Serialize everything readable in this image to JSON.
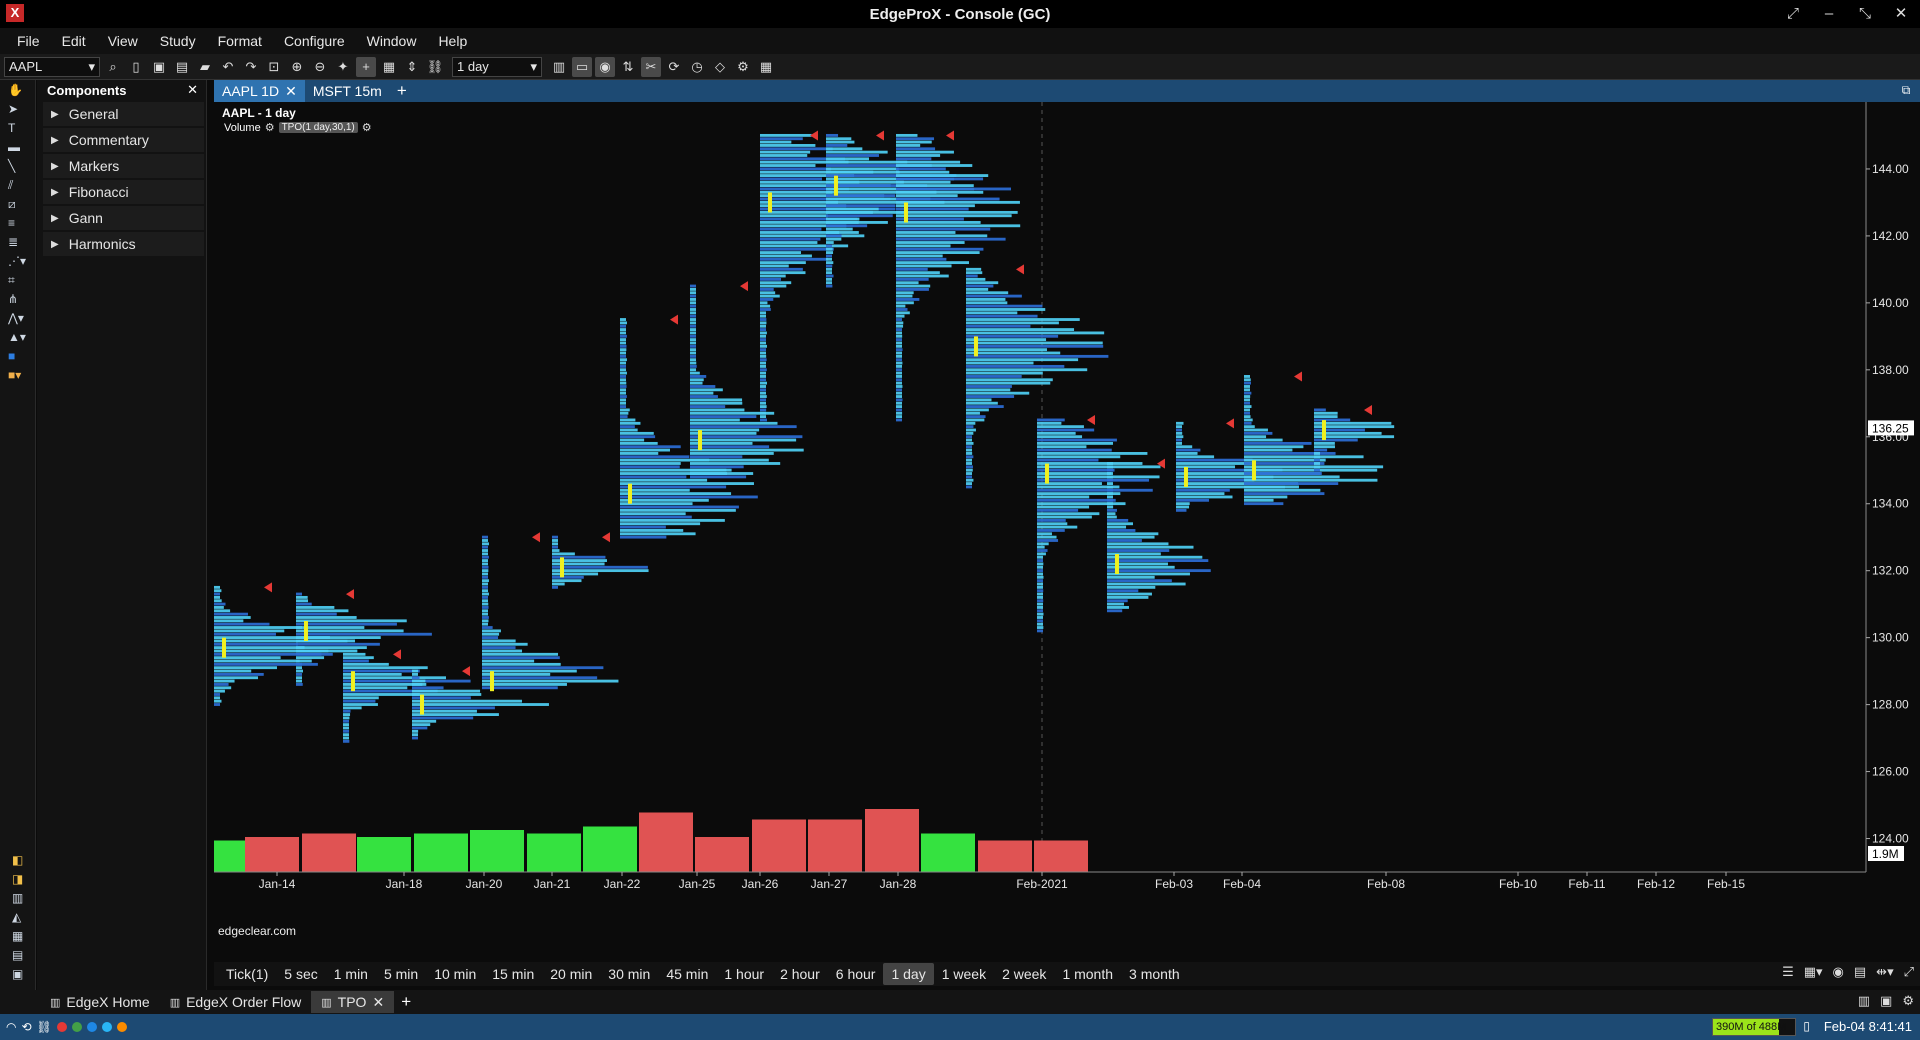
{
  "window": {
    "title": "EdgeProX - Console (GC)",
    "logo": "X"
  },
  "menu": [
    "File",
    "Edit",
    "View",
    "Study",
    "Format",
    "Configure",
    "Window",
    "Help"
  ],
  "toolbar": {
    "symbol": "AAPL",
    "interval": "1 day"
  },
  "components": {
    "title": "Components",
    "items": [
      "General",
      "Commentary",
      "Markers",
      "Fibonacci",
      "Gann",
      "Harmonics"
    ]
  },
  "chart_tabs": [
    {
      "label": "AAPL 1D",
      "active": true
    },
    {
      "label": "MSFT 15m",
      "active": false
    }
  ],
  "chart": {
    "legend_title": "AAPL - 1 day",
    "legend_volume": "Volume",
    "legend_tpo": "TPO(1 day,30,1)",
    "watermark": "edgeclear.com",
    "last_price_label": "136.25",
    "volume_label": "1.9M"
  },
  "chart_data": {
    "type": "bar",
    "description_series": "TPO profiles per day with volume histogram",
    "y_ticks": [
      "144.00",
      "142.00",
      "140.00",
      "138.00",
      "136.00",
      "134.00",
      "132.00",
      "130.00",
      "128.00",
      "126.00",
      "124.00"
    ],
    "ylim": [
      123.0,
      146.0
    ],
    "x_ticks": [
      "Jan-14",
      "Jan-18",
      "Jan-20",
      "Jan-21",
      "Jan-22",
      "Jan-25",
      "Jan-26",
      "Jan-27",
      "Jan-28",
      "Feb-2021",
      "Feb-03",
      "Feb-04",
      "Feb-08",
      "Feb-10",
      "Feb-11",
      "Feb-12",
      "Feb-15"
    ],
    "days": [
      {
        "date": "Jan-14",
        "low": 128.0,
        "high": 131.5,
        "poc": 129.7,
        "width": 1.0,
        "volume": 0.45,
        "up": true
      },
      {
        "date": "Jan-15",
        "low": 128.6,
        "high": 131.3,
        "poc": 130.2,
        "width": 1.0,
        "volume": 0.5,
        "up": false
      },
      {
        "date": "Jan-19",
        "low": 126.9,
        "high": 129.5,
        "poc": 128.7,
        "width": 1.0,
        "volume": 0.55,
        "up": false
      },
      {
        "date": "Jan-20",
        "low": 127.0,
        "high": 129.0,
        "poc": 128.0,
        "width": 1.0,
        "volume": 0.5,
        "up": true
      },
      {
        "date": "Jan-21",
        "low": 128.5,
        "high": 133.0,
        "poc": 128.7,
        "width": 1.0,
        "volume": 0.55,
        "up": true
      },
      {
        "date": "Jan-22",
        "low": 131.5,
        "high": 133.0,
        "poc": 132.1,
        "width": 1.0,
        "volume": 0.6,
        "up": true
      },
      {
        "date": "Jan-25",
        "low": 133.0,
        "high": 139.5,
        "poc": 134.3,
        "width": 1.0,
        "volume": 0.55,
        "up": true
      },
      {
        "date": "Jan-26",
        "low": 134.8,
        "high": 140.5,
        "poc": 135.9,
        "width": 1.0,
        "volume": 0.65,
        "up": true
      },
      {
        "date": "Jan-27",
        "low": 136.5,
        "high": 145.0,
        "poc": 143.0,
        "width": 1.0,
        "volume": 0.85,
        "up": false
      },
      {
        "date": "Jan-28",
        "low": 140.5,
        "high": 145.0,
        "poc": 143.5,
        "width": 1.0,
        "volume": 0.5,
        "up": false
      },
      {
        "date": "Jan-29",
        "low": 136.5,
        "high": 145.0,
        "poc": 142.7,
        "width": 1.0,
        "volume": 0.75,
        "up": false
      },
      {
        "date": "Feb-01",
        "low": 134.5,
        "high": 141.0,
        "poc": 138.7,
        "width": 1.0,
        "volume": 0.75,
        "up": false
      },
      {
        "date": "Feb-02",
        "low": 130.2,
        "high": 136.5,
        "poc": 134.9,
        "width": 1.0,
        "volume": 0.9,
        "up": false
      },
      {
        "date": "Feb-03",
        "low": 130.8,
        "high": 135.2,
        "poc": 132.2,
        "width": 1.0,
        "volume": 0.55,
        "up": true
      },
      {
        "date": "Feb-04",
        "low": 133.8,
        "high": 136.4,
        "poc": 134.8,
        "width": 1.0,
        "volume": 0.45,
        "up": false
      },
      {
        "date": "Feb-05",
        "low": 134.0,
        "high": 137.8,
        "poc": 135.0,
        "width": 1.0,
        "volume": 0.45,
        "up": false
      },
      {
        "date": "Feb-08",
        "low": 135.0,
        "high": 136.8,
        "poc": 136.2,
        "width": 1.0,
        "volume": 0.0,
        "up": false
      }
    ]
  },
  "intervals": [
    {
      "label": "Tick(1)",
      "active": false
    },
    {
      "label": "5 sec",
      "active": false
    },
    {
      "label": "1 min",
      "active": false
    },
    {
      "label": "5 min",
      "active": false
    },
    {
      "label": "10 min",
      "active": false
    },
    {
      "label": "15 min",
      "active": false
    },
    {
      "label": "20 min",
      "active": false
    },
    {
      "label": "30 min",
      "active": false
    },
    {
      "label": "45 min",
      "active": false
    },
    {
      "label": "1 hour",
      "active": false
    },
    {
      "label": "2 hour",
      "active": false
    },
    {
      "label": "6 hour",
      "active": false
    },
    {
      "label": "1 day",
      "active": true
    },
    {
      "label": "1 week",
      "active": false
    },
    {
      "label": "2 week",
      "active": false
    },
    {
      "label": "1 month",
      "active": false
    },
    {
      "label": "3 month",
      "active": false
    }
  ],
  "workspace_tabs": [
    {
      "label": "EdgeX Home",
      "active": false
    },
    {
      "label": "EdgeX Order Flow",
      "active": false
    },
    {
      "label": "TPO",
      "active": true
    }
  ],
  "status": {
    "memory": "390M of 488M",
    "memory_fraction": 0.8,
    "datetime": "Feb-04 8:41:41"
  },
  "colors": {
    "up_volume": "#35e240",
    "down_volume": "#e05353",
    "tpo_light": "#4fd0f5",
    "tpo_dark": "#2d6ed6",
    "poc": "#f0f020",
    "accent": "#1d4a73"
  }
}
